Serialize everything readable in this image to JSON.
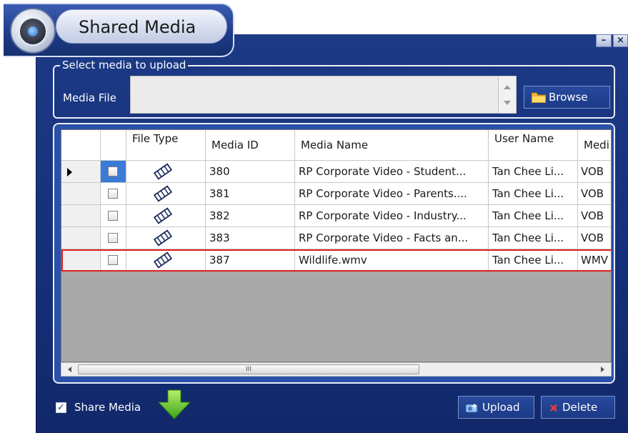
{
  "window": {
    "title": "Shared Media",
    "minimize_glyph": "–",
    "close_glyph": "×"
  },
  "upload": {
    "group_title": "Select media to upload",
    "media_file_label": "Media File",
    "media_file_value": "",
    "browse_label": "Browse"
  },
  "grid": {
    "columns": [
      "File Type",
      "Media ID",
      "Media Name",
      "User Name",
      "Medi"
    ],
    "rows": [
      {
        "media_id": "380",
        "media_name": "RP Corporate Video - Student...",
        "user_name": "Tan Chee Li...",
        "media_type": "VOB",
        "checked": false,
        "current": true
      },
      {
        "media_id": "381",
        "media_name": "RP Corporate Video - Parents....",
        "user_name": "Tan Chee Li...",
        "media_type": "VOB",
        "checked": false
      },
      {
        "media_id": "382",
        "media_name": "RP Corporate Video - Industry...",
        "user_name": "Tan Chee Li...",
        "media_type": "VOB",
        "checked": false
      },
      {
        "media_id": "383",
        "media_name": "RP Corporate Video - Facts an...",
        "user_name": "Tan Chee Li...",
        "media_type": "VOB",
        "checked": false
      },
      {
        "media_id": "387",
        "media_name": "Wildlife.wmv",
        "user_name": "Tan Chee Li...",
        "media_type": "WMV",
        "checked": false,
        "highlighted": true
      }
    ],
    "scroll_thumb_grip": "III"
  },
  "bottom": {
    "share_media_label": "Share Media",
    "share_media_checked": true,
    "upload_label": "Upload",
    "delete_label": "Delete"
  },
  "colors": {
    "accent": "#1b3a86",
    "highlight_border": "#e02020",
    "selected_cell": "#3a7ad8"
  },
  "icons": [
    "app-logo-icon",
    "folder-icon",
    "film-icon",
    "down-arrow-icon",
    "upload-icon",
    "delete-x-icon"
  ]
}
